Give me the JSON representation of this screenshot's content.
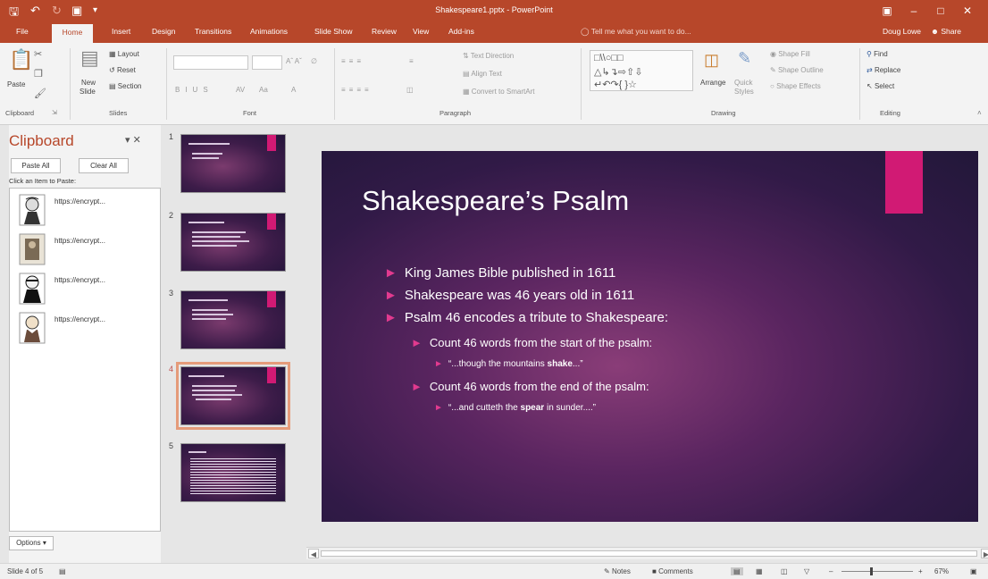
{
  "window": {
    "title": "Shakespeare1.pptx - PowerPoint",
    "accent": "#b7472a"
  },
  "quick_access": {
    "save_icon": "save-icon",
    "undo_icon": "undo-icon",
    "redo_icon": "redo-icon",
    "start_icon": "start-from-beginning-icon"
  },
  "tabs": [
    "File",
    "Home",
    "Insert",
    "Design",
    "Transitions",
    "Animations",
    "Slide Show",
    "Review",
    "View",
    "Add-ins"
  ],
  "tell_me": "Tell me what you want to do...",
  "user": "Doug Lowe",
  "share": "Share",
  "ribbon": {
    "clipboard": {
      "paste": "Paste",
      "group": "Clipboard"
    },
    "slides": {
      "new_slide": "New",
      "new_slide_2": "Slide",
      "layout": "Layout",
      "reset": "Reset",
      "section": "Section",
      "group": "Slides"
    },
    "font": {
      "group": "Font"
    },
    "paragraph": {
      "text_direction": "Text Direction",
      "align_text": "Align Text",
      "convert": "Convert to SmartArt",
      "group": "Paragraph"
    },
    "drawing": {
      "arrange": "Arrange",
      "quick": "Quick",
      "styles": "Styles",
      "shape_fill": "Shape Fill",
      "shape_outline": "Shape Outline",
      "shape_effects": "Shape Effects",
      "group": "Drawing"
    },
    "editing": {
      "find": "Find",
      "replace": "Replace",
      "select": "Select",
      "group": "Editing"
    }
  },
  "clipboard_pane": {
    "title": "Clipboard",
    "paste_all": "Paste All",
    "clear_all": "Clear All",
    "hint": "Click an Item to Paste:",
    "items": [
      {
        "text": "https://encrypt..."
      },
      {
        "text": "https://encrypt..."
      },
      {
        "text": "https://encrypt..."
      },
      {
        "text": "https://encrypt..."
      }
    ],
    "options": "Options"
  },
  "thumbnails": [
    {
      "num": "1"
    },
    {
      "num": "2"
    },
    {
      "num": "3"
    },
    {
      "num": "4"
    },
    {
      "num": "5"
    }
  ],
  "slide": {
    "title": "Shakespeare’s Psalm",
    "bullets": [
      "King James Bible published in 1611",
      "Shakespeare was 46 years old in 1611",
      "Psalm 46 encodes a tribute to Shakespeare:"
    ],
    "sub1": "Count 46 words from the start of the psalm:",
    "quote1_pre": "“...though the mountains ",
    "quote1_bold": "shake",
    "quote1_post": "...”",
    "sub2": "Count 46 words from the end of the psalm:",
    "quote2_pre": "“...and cutteth the ",
    "quote2_bold": "spear",
    "quote2_post": " in sunder....”",
    "accent": "#d11a74"
  },
  "status": {
    "slide_of": "Slide 4 of 5",
    "notes": "Notes",
    "comments": "Comments",
    "zoom": "67%"
  }
}
